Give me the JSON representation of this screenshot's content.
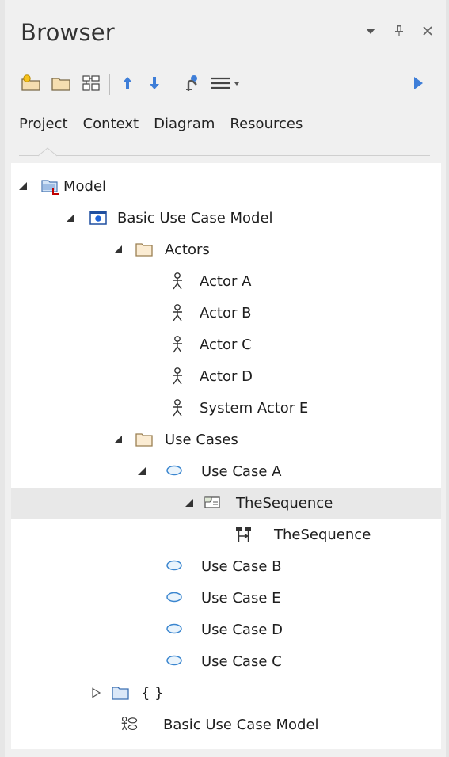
{
  "window": {
    "title": "Browser",
    "controls": [
      "dropdown-icon",
      "pin-icon",
      "close-icon"
    ]
  },
  "toolbar": {
    "icons": [
      "new-package-icon",
      "new-folder-icon",
      "new-diagram-icon",
      "move-up-icon",
      "move-down-icon",
      "add-element-icon",
      "menu-icon",
      "expand-panel-icon"
    ]
  },
  "tabs": [
    {
      "label": "Project",
      "active": true
    },
    {
      "label": "Context"
    },
    {
      "label": "Diagram"
    },
    {
      "label": "Resources"
    }
  ],
  "tree": {
    "nodes": [
      {
        "label": "Model",
        "icon": "model-package-icon",
        "expander": "expanded"
      },
      {
        "label": "Basic Use Case Model",
        "icon": "model-icon",
        "expander": "expanded"
      },
      {
        "label": "Actors",
        "icon": "folder-icon",
        "expander": "expanded"
      },
      {
        "label": "Actor A",
        "icon": "actor-icon"
      },
      {
        "label": "Actor B",
        "icon": "actor-icon"
      },
      {
        "label": "Actor C",
        "icon": "actor-icon"
      },
      {
        "label": "Actor D",
        "icon": "actor-icon"
      },
      {
        "label": "System Actor E",
        "icon": "actor-icon"
      },
      {
        "label": "Use Cases",
        "icon": "folder-icon",
        "expander": "expanded"
      },
      {
        "label": "Use Case A",
        "icon": "use-case-icon",
        "expander": "expanded"
      },
      {
        "label": "TheSequence",
        "icon": "interaction-icon",
        "expander": "expanded",
        "selected": true
      },
      {
        "label": "TheSequence",
        "icon": "sequence-diagram-icon"
      },
      {
        "label": "Use Case B",
        "icon": "use-case-icon"
      },
      {
        "label": "Use Case E",
        "icon": "use-case-icon"
      },
      {
        "label": "Use Case D",
        "icon": "use-case-icon"
      },
      {
        "label": "Use Case C",
        "icon": "use-case-icon"
      },
      {
        "label": "{ }",
        "icon": "folder-icon",
        "expander": "collapsed"
      },
      {
        "label": "Basic Use Case Model",
        "icon": "use-case-diagram-icon"
      }
    ]
  }
}
